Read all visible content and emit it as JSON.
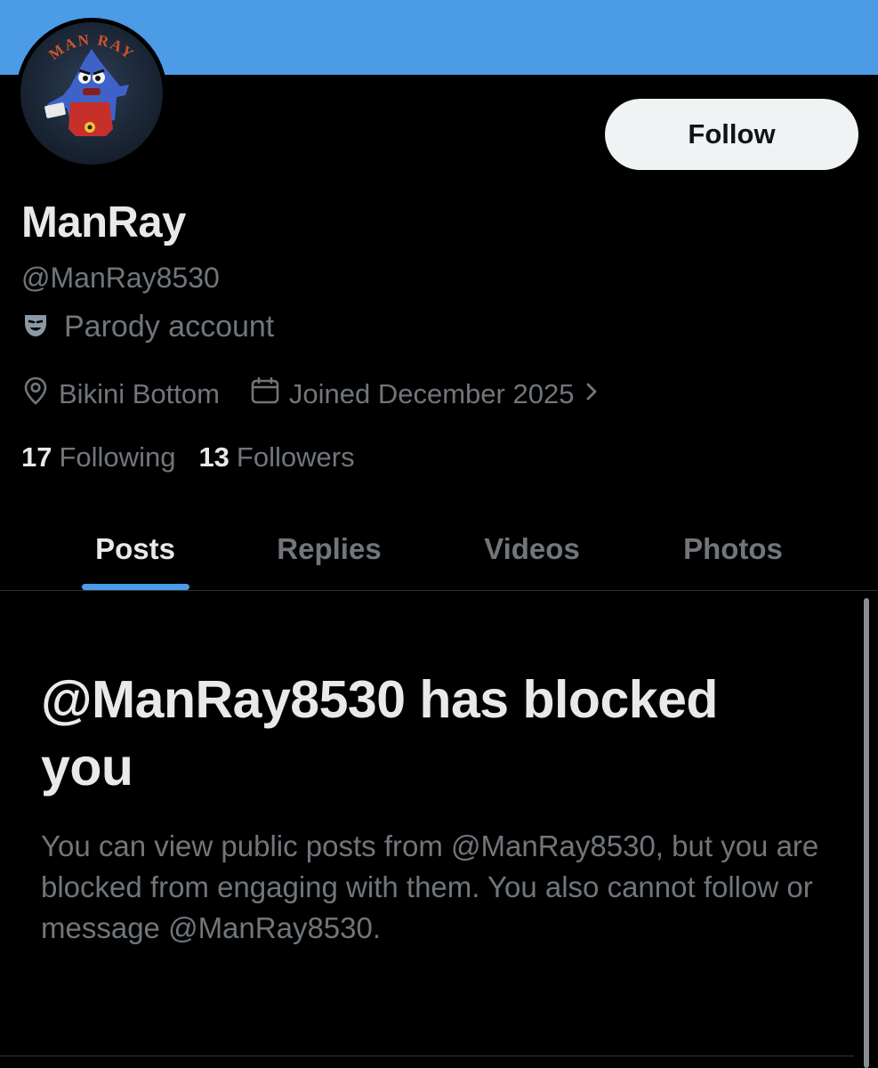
{
  "profile": {
    "avatar_ring_text": "MAN RAY",
    "display_name": "ManRay",
    "handle": "@ManRay8530",
    "label": "Parody account",
    "label_icon": "theater-masks-icon",
    "location": "Bikini Bottom",
    "joined": "Joined December 2025",
    "follow_label": "Follow"
  },
  "stats": {
    "following_count": "17",
    "following_label": "Following",
    "followers_count": "13",
    "followers_label": "Followers"
  },
  "tabs": [
    {
      "label": "Posts",
      "active": true
    },
    {
      "label": "Replies",
      "active": false
    },
    {
      "label": "Videos",
      "active": false
    },
    {
      "label": "Photos",
      "active": false
    }
  ],
  "blocked": {
    "title": "@ManRay8530 has blocked you",
    "body": "You can view public posts from @ManRay8530, but you are blocked from engaging with them. You also cannot follow or message @ManRay8530."
  },
  "colors": {
    "banner": "#4b9be6",
    "accent": "#4b9be6",
    "background": "#000000",
    "primary_text": "#e7e9ea",
    "secondary_text": "#71767b"
  }
}
